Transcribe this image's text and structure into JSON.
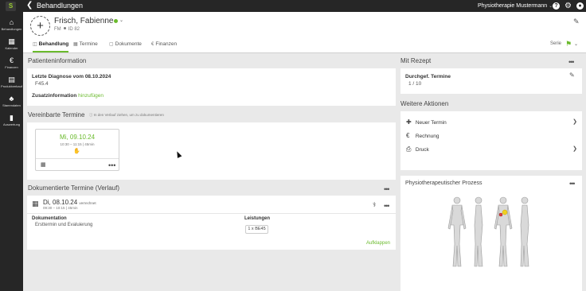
{
  "app": {
    "title": "Behandlungen",
    "practice": "Physiotherapie Mustermann",
    "logo": "S"
  },
  "nav": [
    {
      "label": "Behandlungen",
      "icon": "home-icon",
      "glyph": "⌂"
    },
    {
      "label": "Kalender",
      "icon": "calendar-icon",
      "glyph": "▦"
    },
    {
      "label": "Finanzen",
      "icon": "euro-icon",
      "glyph": "€"
    },
    {
      "label": "Produktverkauf",
      "icon": "document-icon",
      "glyph": "▤"
    },
    {
      "label": "Stammdaten",
      "icon": "sitemap-icon",
      "glyph": "♣"
    },
    {
      "label": "Auswertung",
      "icon": "bar-chart-icon",
      "glyph": "▮"
    }
  ],
  "patient": {
    "name": "Frisch, Fabienne",
    "initials": "FM",
    "id": "ID 82",
    "avatar_glyph": "+"
  },
  "tabs": [
    {
      "label": "Behandlung",
      "icon": "bookmark-icon",
      "glyph": "◫",
      "active": true
    },
    {
      "label": "Termine",
      "icon": "calendar-icon",
      "glyph": "▦",
      "active": false
    },
    {
      "label": "Dokumente",
      "icon": "document-icon",
      "glyph": "▢",
      "active": false
    },
    {
      "label": "Finanzen",
      "icon": "euro-icon",
      "glyph": "€",
      "active": false
    }
  ],
  "serie": {
    "label": "Serie"
  },
  "patientinfo": {
    "title": "Patienteninformation",
    "diagnose_label": "Letzte Diagnose vom 08.10.2024",
    "diagnose_code": "F45.4",
    "zusatz_label": "Zusatzinformation",
    "zusatz_link": "hinzufügen"
  },
  "rezept": {
    "title": "Mit Rezept",
    "label": "Durchgef. Termine",
    "value": "1 / 10"
  },
  "vereinbart": {
    "title": "Vereinbarte Termine",
    "note": "In den Verlauf ziehen, um zu dokumentieren",
    "appointment": {
      "date": "Mi, 09.10.24",
      "time": "10:30 – 11:15 | 45min"
    }
  },
  "aktionen": {
    "title": "Weitere Aktionen",
    "items": [
      {
        "label": "Neuer Termin",
        "icon": "plus-icon",
        "glyph": "✚"
      },
      {
        "label": "Rechnung",
        "icon": "euro-icon",
        "glyph": "€"
      },
      {
        "label": "Druck",
        "icon": "printer-icon",
        "glyph": "⎙"
      }
    ]
  },
  "dokumentiert": {
    "title": "Dokumentierte Termine (Verlauf)",
    "entry": {
      "date": "Di, 08.10.24",
      "badge": "verrechnet",
      "time": "09:30 – 10:15 | 45min"
    },
    "dok_label": "Dokumentation",
    "dok_value": "Ersttermin und Evaluierung",
    "leist_label": "Leistungen",
    "leist_value": "1 x BE45",
    "expand": "Aufklappen"
  },
  "prozess": {
    "title": "Physiotherapeutischer Prozess"
  },
  "colors": {
    "accent": "#6aba2c",
    "topbar": "#262626",
    "background": "#e9e9e9"
  }
}
